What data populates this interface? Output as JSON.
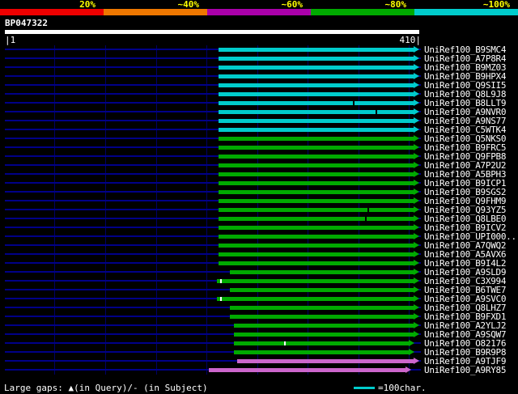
{
  "scale": {
    "segments": [
      {
        "label": "20%",
        "color": "#ee0000"
      },
      {
        "label": "~40%",
        "color": "#ee7700"
      },
      {
        "label": "~60%",
        "color": "#aa00aa"
      },
      {
        "label": "~80%",
        "color": "#00aa00"
      },
      {
        "label": "~100%",
        "color": "#00cccc"
      }
    ]
  },
  "query": {
    "id": "BP047322",
    "start_label": "|1",
    "end_label": "410|",
    "length": 410
  },
  "footer": {
    "gaps_text": "Large gaps: ▲(in Query)/- (in Subject)",
    "scale_text": "=100char.",
    "scale_line_color": "#00cccc"
  },
  "chart_data": {
    "type": "bar",
    "title": "BP047322",
    "xlabel": "",
    "xlim": [
      1,
      410
    ],
    "grid": true,
    "grid_interval": 50,
    "legend_position": "top",
    "legend": [
      "20%",
      "~40%",
      "~60%",
      "~80%",
      "~100%"
    ],
    "identity_colors": {
      "~100%": "#00cccc",
      "~80%": "#00aa00",
      "~60%": "#cc66cc"
    },
    "hits": [
      {
        "name": "UniRef100_B9SMC4",
        "qstart": 212,
        "qend": 410,
        "color": "#00cccc",
        "gaps": []
      },
      {
        "name": "UniRef100_A7P8R4",
        "qstart": 212,
        "qend": 410,
        "color": "#00cccc",
        "gaps": []
      },
      {
        "name": "UniRef100_B9MZ03",
        "qstart": 212,
        "qend": 410,
        "color": "#00cccc",
        "gaps": []
      },
      {
        "name": "UniRef100_B9HPX4",
        "qstart": 212,
        "qend": 410,
        "color": "#00cccc",
        "gaps": []
      },
      {
        "name": "UniRef100_Q9SII5",
        "qstart": 212,
        "qend": 410,
        "color": "#00cccc",
        "gaps": []
      },
      {
        "name": "UniRef100_Q8L9J8",
        "qstart": 212,
        "qend": 410,
        "color": "#00cccc",
        "gaps": []
      },
      {
        "name": "UniRef100_B8LLT9",
        "qstart": 212,
        "qend": 410,
        "color": "#00cccc",
        "gaps": [
          {
            "pos": 345,
            "color": "#000000"
          }
        ]
      },
      {
        "name": "UniRef100_A9NVR0",
        "qstart": 212,
        "qend": 410,
        "color": "#00cccc",
        "gaps": [
          {
            "pos": 368,
            "color": "#000000"
          }
        ]
      },
      {
        "name": "UniRef100_A9NS77",
        "qstart": 212,
        "qend": 410,
        "color": "#00cccc",
        "gaps": []
      },
      {
        "name": "UniRef100_C5WTK4",
        "qstart": 212,
        "qend": 410,
        "color": "#00cccc",
        "gaps": []
      },
      {
        "name": "UniRef100_Q5NKS0",
        "qstart": 212,
        "qend": 410,
        "color": "#00aa00",
        "gaps": []
      },
      {
        "name": "UniRef100_B9FRC5",
        "qstart": 212,
        "qend": 410,
        "color": "#00aa00",
        "gaps": []
      },
      {
        "name": "UniRef100_Q9FPB8",
        "qstart": 212,
        "qend": 410,
        "color": "#00aa00",
        "gaps": []
      },
      {
        "name": "UniRef100_A7P2U2",
        "qstart": 212,
        "qend": 410,
        "color": "#00aa00",
        "gaps": []
      },
      {
        "name": "UniRef100_A5BPH3",
        "qstart": 212,
        "qend": 410,
        "color": "#00aa00",
        "gaps": []
      },
      {
        "name": "UniRef100_B9ICP1",
        "qstart": 212,
        "qend": 410,
        "color": "#00aa00",
        "gaps": []
      },
      {
        "name": "UniRef100_B9SGS2",
        "qstart": 212,
        "qend": 410,
        "color": "#00aa00",
        "gaps": []
      },
      {
        "name": "UniRef100_Q9FHM9",
        "qstart": 212,
        "qend": 410,
        "color": "#00aa00",
        "gaps": []
      },
      {
        "name": "UniRef100_Q93YZ5",
        "qstart": 212,
        "qend": 410,
        "color": "#00aa00",
        "gaps": [
          {
            "pos": 360,
            "color": "#000000"
          }
        ]
      },
      {
        "name": "UniRef100_Q8LBE0",
        "qstart": 212,
        "qend": 410,
        "color": "#00aa00",
        "gaps": [
          {
            "pos": 357,
            "color": "#000000"
          }
        ]
      },
      {
        "name": "UniRef100_B9ICV2",
        "qstart": 212,
        "qend": 410,
        "color": "#00aa00",
        "gaps": []
      },
      {
        "name": "UniRef100_UPI000..",
        "qstart": 212,
        "qend": 410,
        "color": "#00aa00",
        "gaps": []
      },
      {
        "name": "UniRef100_A7QWQ2",
        "qstart": 212,
        "qend": 410,
        "color": "#00aa00",
        "gaps": []
      },
      {
        "name": "UniRef100_A5AVX6",
        "qstart": 212,
        "qend": 410,
        "color": "#00aa00",
        "gaps": []
      },
      {
        "name": "UniRef100_B9I4L2",
        "qstart": 212,
        "qend": 410,
        "color": "#00aa00",
        "gaps": []
      },
      {
        "name": "UniRef100_A9SLD9",
        "qstart": 223,
        "qend": 410,
        "color": "#00aa00",
        "gaps": []
      },
      {
        "name": "UniRef100_C3X994",
        "qstart": 210,
        "qend": 410,
        "color": "#00aa00",
        "gaps": [
          {
            "pos": 214,
            "color": "#ffffff"
          }
        ]
      },
      {
        "name": "UniRef100_B6TWE7",
        "qstart": 223,
        "qend": 410,
        "color": "#00aa00",
        "gaps": []
      },
      {
        "name": "UniRef100_A9SVC0",
        "qstart": 210,
        "qend": 410,
        "color": "#00aa00",
        "gaps": [
          {
            "pos": 214,
            "color": "#ffffff"
          }
        ]
      },
      {
        "name": "UniRef100_Q8LHZ7",
        "qstart": 223,
        "qend": 410,
        "color": "#00aa00",
        "gaps": []
      },
      {
        "name": "UniRef100_B9FXD1",
        "qstart": 223,
        "qend": 410,
        "color": "#00aa00",
        "gaps": []
      },
      {
        "name": "UniRef100_A2YLJ2",
        "qstart": 227,
        "qend": 410,
        "color": "#00aa00",
        "gaps": []
      },
      {
        "name": "UniRef100_A9SQW7",
        "qstart": 227,
        "qend": 410,
        "color": "#00aa00",
        "gaps": []
      },
      {
        "name": "UniRef100_O82176",
        "qstart": 227,
        "qend": 405,
        "color": "#00aa00",
        "gaps": [
          {
            "pos": 277,
            "color": "#ffffff"
          }
        ]
      },
      {
        "name": "UniRef100_B9R9P8",
        "qstart": 227,
        "qend": 405,
        "color": "#00aa00",
        "gaps": []
      },
      {
        "name": "UniRef100_A9TJF9",
        "qstart": 230,
        "qend": 410,
        "color": "#cc66cc",
        "gaps": []
      },
      {
        "name": "UniRef100_A9RY85",
        "qstart": 202,
        "qend": 402,
        "color": "#cc66cc",
        "gaps": []
      }
    ]
  }
}
